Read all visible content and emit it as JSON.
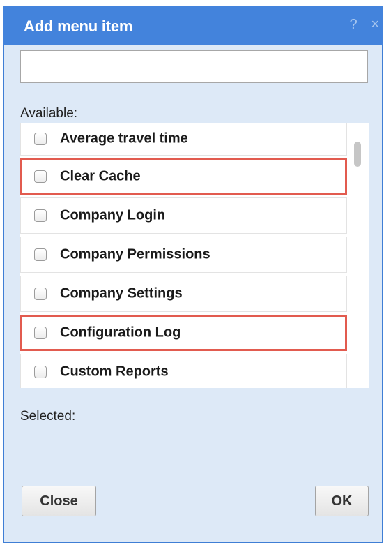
{
  "dialog": {
    "title": "Add menu item",
    "help_icon": "?",
    "close_icon": "×"
  },
  "name_input": {
    "value": "",
    "placeholder": ""
  },
  "available": {
    "label": "Available:",
    "items": [
      {
        "label": "Average travel time",
        "checked": false,
        "highlighted": false
      },
      {
        "label": "Clear Cache",
        "checked": false,
        "highlighted": true
      },
      {
        "label": "Company Login",
        "checked": false,
        "highlighted": false
      },
      {
        "label": "Company Permissions",
        "checked": false,
        "highlighted": false
      },
      {
        "label": "Company Settings",
        "checked": false,
        "highlighted": false
      },
      {
        "label": "Configuration Log",
        "checked": false,
        "highlighted": true
      },
      {
        "label": "Custom Reports",
        "checked": false,
        "highlighted": false
      }
    ]
  },
  "selected": {
    "label": "Selected:"
  },
  "buttons": {
    "close_label": "Close",
    "ok_label": "OK"
  },
  "colors": {
    "titlebar": "#4383dc",
    "dialog_bg": "#dde9f7",
    "highlight_border": "#e25b4f"
  }
}
